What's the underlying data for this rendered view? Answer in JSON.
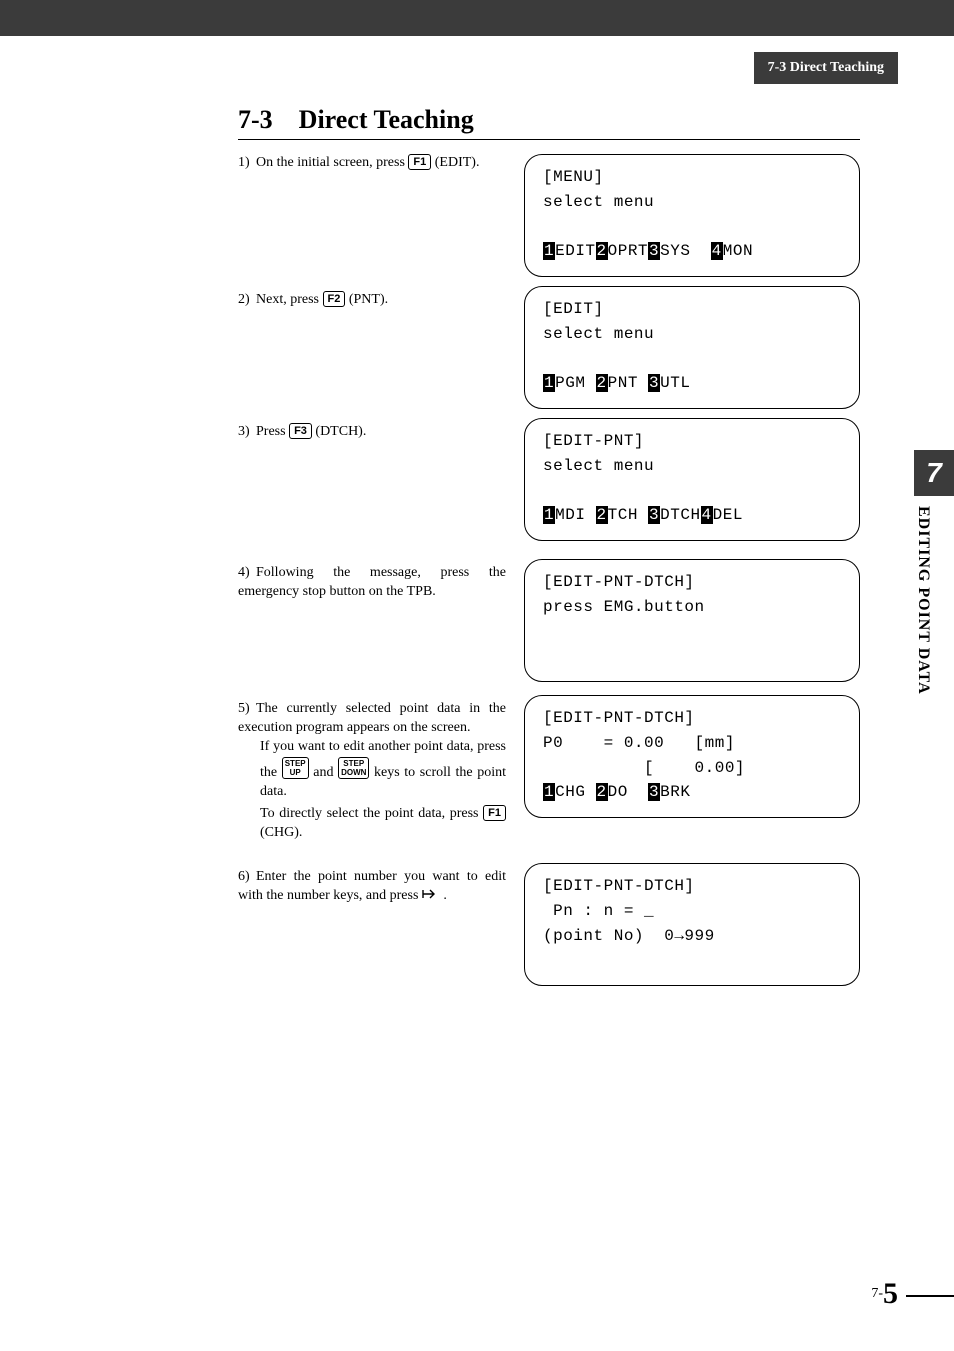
{
  "header": {
    "crumb": "7-3 Direct Teaching"
  },
  "section": {
    "number": "7-3",
    "title": "Direct Teaching"
  },
  "steps": {
    "s1": {
      "num": "1)",
      "a": "On the initial screen, press ",
      "b": " (EDIT).",
      "key": "F1"
    },
    "s2": {
      "num": "2)",
      "a": "Next, press ",
      "b": " (PNT).",
      "key": "F2"
    },
    "s3": {
      "num": "3)",
      "a": "Press ",
      "b": " (DTCH).",
      "key": "F3"
    },
    "s4": {
      "num": "4)",
      "a": "Following the message, press the emergency stop button on the TPB."
    },
    "s5": {
      "num": "5)",
      "p1": "The currently selected point data in the execution program appears on the screen.",
      "p2a": "If you want to edit another point data, press the ",
      "p2b": " and ",
      "p2c": " keys to scroll the point data.",
      "key_up_l1": "STEP",
      "key_up_l2": "UP",
      "key_dn_l1": "STEP",
      "key_dn_l2": "DOWN",
      "p3a": "To directly select the point data, press ",
      "p3b": " (CHG).",
      "key3": "F1"
    },
    "s6": {
      "num": "6)",
      "a": "Enter the point number you want to edit with the number keys, and press ",
      "b": " ."
    }
  },
  "lcd": {
    "l1": {
      "title": "[MENU]",
      "line2": "select menu",
      "m1n": "1",
      "m1": "EDIT",
      "m2n": "2",
      "m2": "OPRT",
      "m3n": "3",
      "m3": "SYS ",
      "m4n": "4",
      "m4": "MON"
    },
    "l2": {
      "title": "[EDIT]",
      "line2": "select menu",
      "m1n": "1",
      "m1": "PGM ",
      "m2n": "2",
      "m2": "PNT ",
      "m3n": "3",
      "m3": "UTL"
    },
    "l3": {
      "title": "[EDIT-PNT]",
      "line2": "select menu",
      "m1n": "1",
      "m1": "MDI ",
      "m2n": "2",
      "m2": "TCH ",
      "m3n": "3",
      "m3": "DTCH",
      "m4n": "4",
      "m4": "DEL"
    },
    "l4": {
      "title": "[EDIT-PNT-DTCH]",
      "line2": "press EMG.button"
    },
    "l5": {
      "title": "[EDIT-PNT-DTCH]",
      "line2": "P0    = 0.00   [mm]",
      "line3": "          [    0.00]",
      "m1n": "1",
      "m1": "CHG ",
      "m2n": "2",
      "m2": "DO  ",
      "m3n": "3",
      "m3": "BRK"
    },
    "l6": {
      "title": "[EDIT-PNT-DTCH]",
      "line2": " Pn : n = _",
      "line3": "(point No)  0→999"
    }
  },
  "sidetab": {
    "number": "7",
    "label": "EDITING POINT DATA"
  },
  "footer": {
    "chapter": "7-",
    "page": "5"
  }
}
